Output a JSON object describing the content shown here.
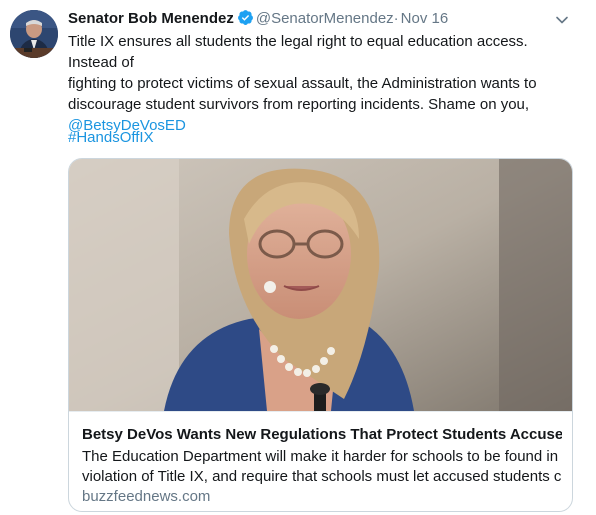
{
  "tweet": {
    "author": {
      "display_name": "Senator Bob Menendez",
      "handle": "@SenatorMenendez",
      "verified": true
    },
    "separator": "·",
    "date": "Nov 16",
    "text_lines": [
      "Title IX ensures all students the legal right to equal education access. Instead of",
      "fighting to protect victims of sexual assault, the Administration wants to",
      "discourage student survivors from reporting incidents. Shame on you,"
    ],
    "mention": "@BetsyDeVosED",
    "hashtag": "#HandsOffIX",
    "card": {
      "title": "Betsy DeVos Wants New Regulations That Protect Students Accused...",
      "description_lines": [
        "The Education Department will make it harder for schools to be found in",
        "violation of Title IX, and require that schools must let accused students cr..."
      ],
      "domain": "buzzfeednews.com"
    }
  },
  "colors": {
    "link": "#1b95e0",
    "verified": "#1da1f2",
    "muted": "#657786",
    "border": "#ccd6dd"
  },
  "icons": {
    "verified": "verified-badge-icon",
    "caret": "chevron-down-icon"
  }
}
